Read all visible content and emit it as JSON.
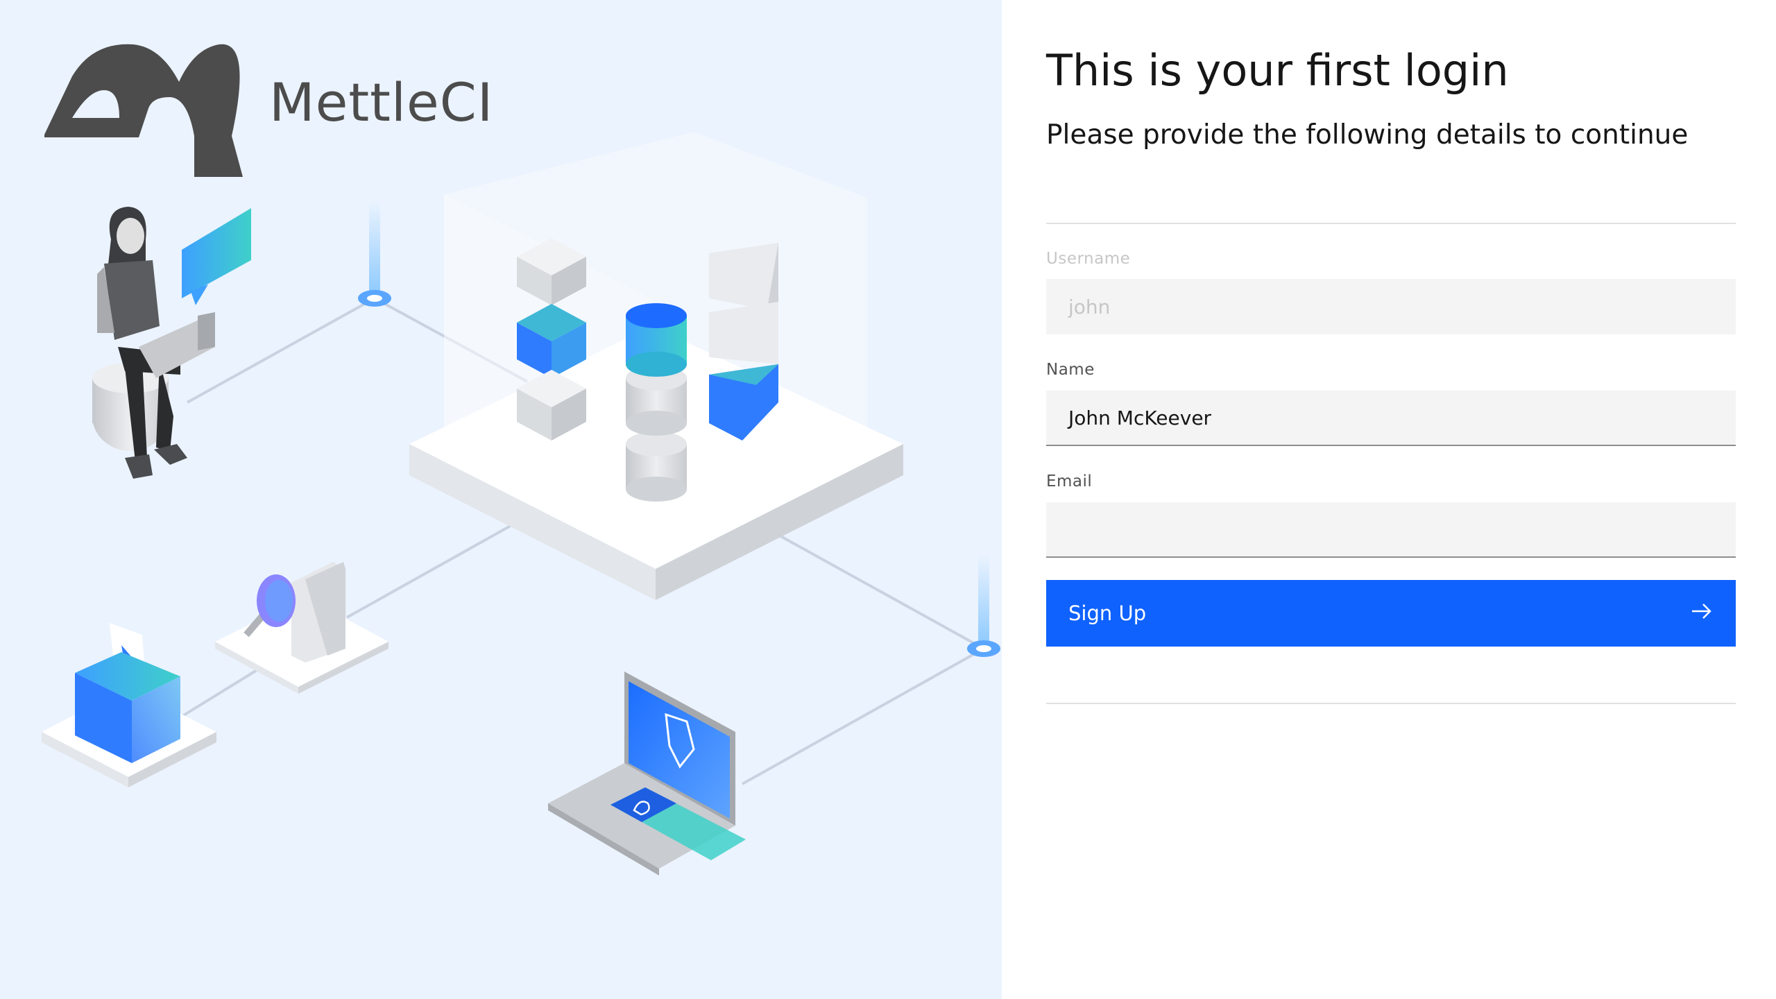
{
  "brand": {
    "name": "MettleCI"
  },
  "form": {
    "title": "This is your first login",
    "subtitle": "Please provide the following details to continue",
    "fields": {
      "username": {
        "label": "Username",
        "value": "john",
        "disabled": true
      },
      "name": {
        "label": "Name",
        "value": "John McKeever"
      },
      "email": {
        "label": "Email",
        "value": ""
      }
    },
    "submit": {
      "label": "Sign Up",
      "icon": "arrow-right-icon"
    }
  },
  "colors": {
    "accent": "#0f62fe",
    "left_background": "#ebf3fe",
    "logo": "#4c4c4c"
  }
}
